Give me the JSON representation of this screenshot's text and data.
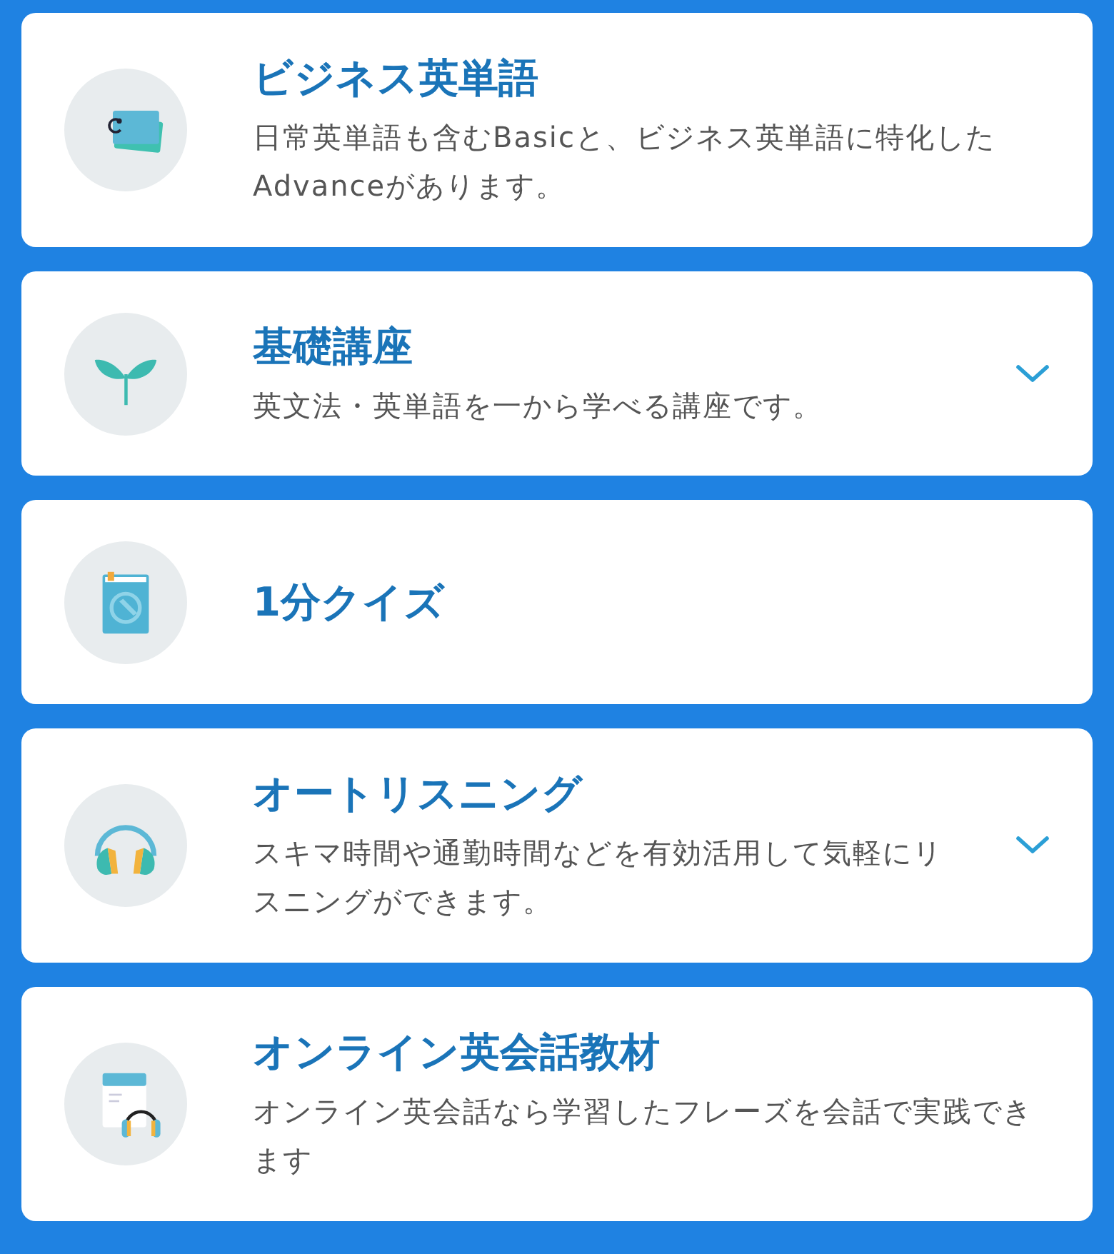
{
  "courses": [
    {
      "kind": "cards",
      "title": "ビジネス英単語",
      "description": "日常英単語も含むBasicと、ビジネス英単語に特化したAdvanceがあります。",
      "expandable": false
    },
    {
      "kind": "sprout",
      "title": "基礎講座",
      "description": "英文法・英単語を一から学べる講座です。",
      "expandable": true
    },
    {
      "kind": "book",
      "title": "1分クイズ",
      "expandable": false
    },
    {
      "kind": "headphones",
      "title": "オートリスニング",
      "description": "スキマ時間や通勤時間などを有効活用して気軽にリスニングができます。",
      "expandable": true
    },
    {
      "kind": "document-headphones",
      "title": "オンライン英会話教材",
      "description": "オンライン英会話なら学習したフレーズを会話で実践できます",
      "expandable": false
    }
  ]
}
